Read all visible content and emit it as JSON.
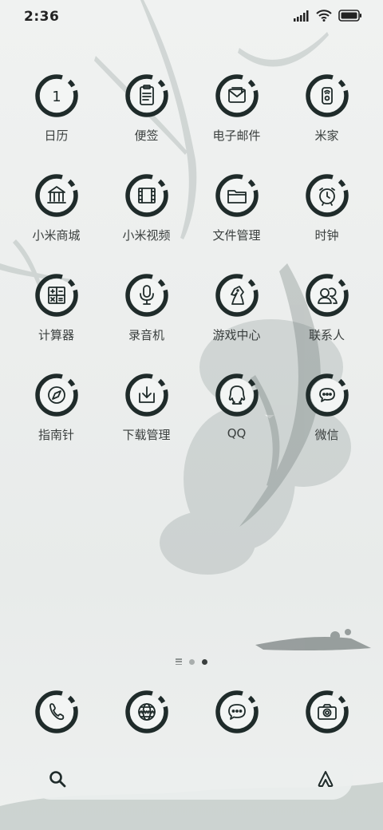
{
  "status_bar": {
    "time": "2:36",
    "battery_icon": "battery-icon",
    "wifi_icon": "wifi-icon",
    "signal_icon": "signal-icon"
  },
  "apps": [
    {
      "label": "日历",
      "icon": "calendar-icon",
      "glyph": "1"
    },
    {
      "label": "便签",
      "icon": "notes-icon"
    },
    {
      "label": "电子邮件",
      "icon": "mail-icon"
    },
    {
      "label": "米家",
      "icon": "mijia-icon"
    },
    {
      "label": "小米商城",
      "icon": "store-icon"
    },
    {
      "label": "小米视频",
      "icon": "video-icon"
    },
    {
      "label": "文件管理",
      "icon": "folder-icon"
    },
    {
      "label": "时钟",
      "icon": "clock-icon"
    },
    {
      "label": "计算器",
      "icon": "calculator-icon"
    },
    {
      "label": "录音机",
      "icon": "recorder-icon"
    },
    {
      "label": "游戏中心",
      "icon": "game-center-icon"
    },
    {
      "label": "联系人",
      "icon": "contacts-icon"
    },
    {
      "label": "指南针",
      "icon": "compass-icon"
    },
    {
      "label": "下载管理",
      "icon": "download-icon"
    },
    {
      "label": "QQ",
      "icon": "qq-icon"
    },
    {
      "label": "微信",
      "icon": "wechat-icon"
    }
  ],
  "dock": [
    {
      "icon": "phone-icon"
    },
    {
      "icon": "browser-icon"
    },
    {
      "icon": "messages-icon"
    },
    {
      "icon": "camera-icon"
    }
  ],
  "page_indicator": {
    "pages": 3,
    "current": 3
  },
  "search_bar": {
    "left_icon": "search-icon",
    "right_icon": "assistant-icon"
  },
  "colors": {
    "ink": "#1f2b2a",
    "label": "#3a3f3e",
    "background": "#eef0ef"
  }
}
